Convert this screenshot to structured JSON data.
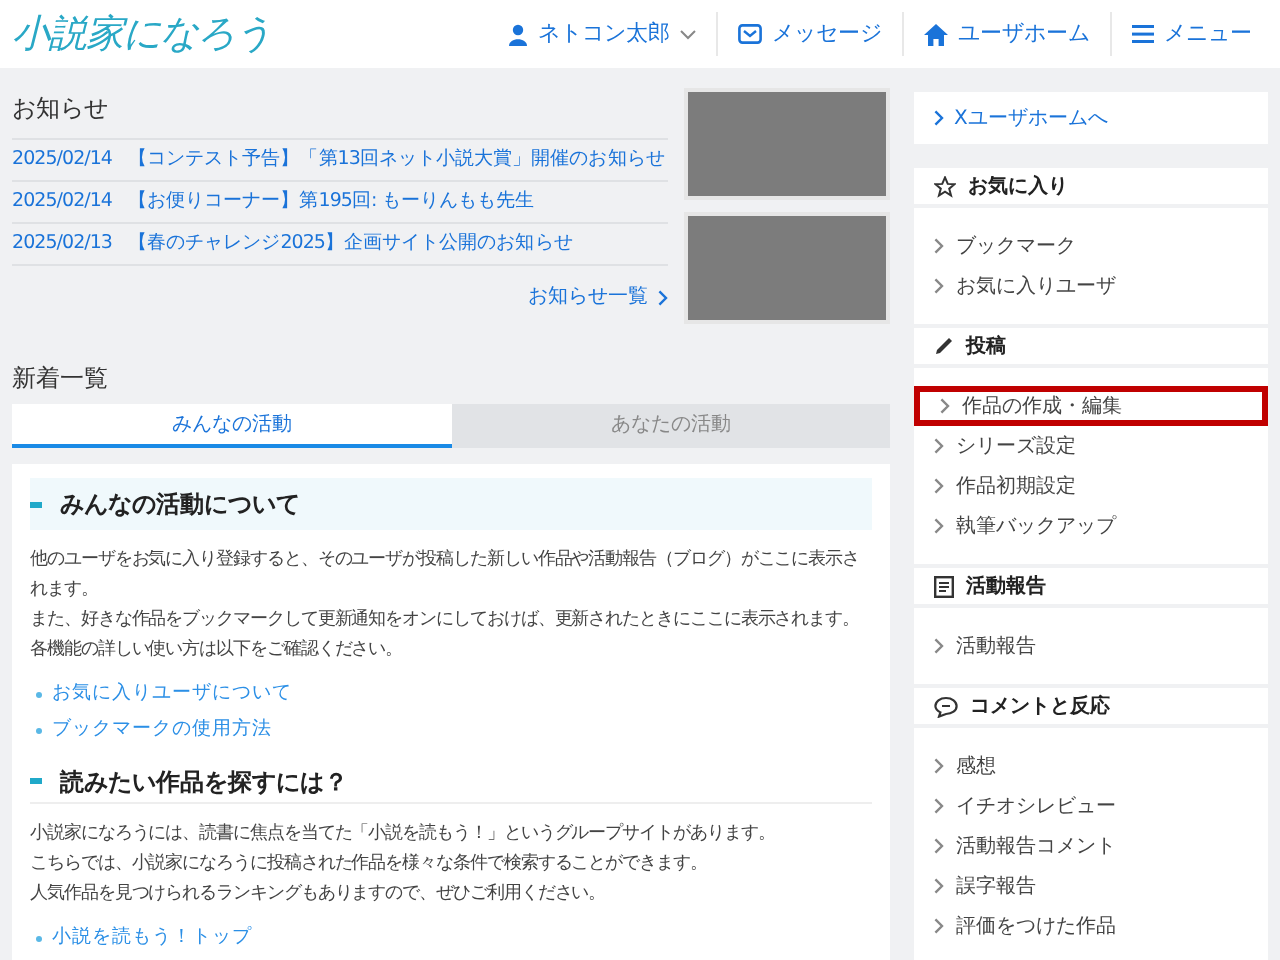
{
  "header": {
    "logo": "小説家になろう",
    "nav": [
      {
        "kind": "user",
        "label": "ネトコン太郎"
      },
      {
        "kind": "message",
        "label": "メッセージ"
      },
      {
        "kind": "home",
        "label": "ユーザホーム"
      },
      {
        "kind": "menu",
        "label": "メニュー"
      }
    ]
  },
  "notices": {
    "title": "お知らせ",
    "items": [
      {
        "date": "2025/02/14",
        "text": "【コンテスト予告】「第13回ネット小説大賞」開催のお知らせ"
      },
      {
        "date": "2025/02/14",
        "text": "【お便りコーナー】第195回: もーりんもも先生"
      },
      {
        "date": "2025/02/13",
        "text": "【春のチャレンジ2025】企画サイト公開のお知らせ"
      }
    ],
    "more": "お知らせ一覧"
  },
  "feed": {
    "title": "新着一覧",
    "tabs": [
      {
        "label": "みんなの活動",
        "selected": true
      },
      {
        "label": "あなたの活動",
        "selected": false
      }
    ],
    "sections": [
      {
        "heading": "みんなの活動について",
        "kind": "boxed",
        "paragraphs": [
          "他のユーザをお気に入り登録すると、そのユーザが投稿した新しい作品や活動報告（ブログ）がここに表示されます。",
          "また、好きな作品をブックマークして更新通知をオンにしておけば、更新されたときにここに表示されます。",
          "各機能の詳しい使い方は以下をご確認ください。"
        ],
        "links": [
          "お気に入りユーザについて",
          "ブックマークの使用方法"
        ]
      },
      {
        "heading": "読みたい作品を探すには？",
        "kind": "underlined",
        "paragraphs": [
          "小説家になろうには、読書に焦点を当てた「小説を読もう！」というグループサイトがあります。",
          "こちらでは、小説家になろうに投稿された作品を様々な条件で検索することができます。",
          "人気作品を見つけられるランキングもありますので、ぜひご利用ください。"
        ],
        "links": [
          "小説を読もう！トップ"
        ]
      }
    ]
  },
  "sidebar": {
    "top_link": "Xユーザホームへ",
    "groups": [
      {
        "title": "お気に入り",
        "items": [
          {
            "label": "ブックマーク",
            "highlighted": false
          },
          {
            "label": "お気に入りユーザ",
            "highlighted": false
          }
        ]
      },
      {
        "title": "投稿",
        "items": [
          {
            "label": "作品の作成・編集",
            "highlighted": true
          },
          {
            "label": "シリーズ設定",
            "highlighted": false
          },
          {
            "label": "作品初期設定",
            "highlighted": false
          },
          {
            "label": "執筆バックアップ",
            "highlighted": false
          }
        ]
      },
      {
        "title": "活動報告",
        "items": [
          {
            "label": "活動報告",
            "highlighted": false
          }
        ]
      },
      {
        "title": "コメントと反応",
        "items": [
          {
            "label": "感想",
            "highlighted": false
          },
          {
            "label": "イチオシレビュー",
            "highlighted": false
          },
          {
            "label": "活動報告コメント",
            "highlighted": false
          },
          {
            "label": "誤字報告",
            "highlighted": false
          },
          {
            "label": "評価をつけた作品",
            "highlighted": false
          }
        ]
      }
    ]
  }
}
